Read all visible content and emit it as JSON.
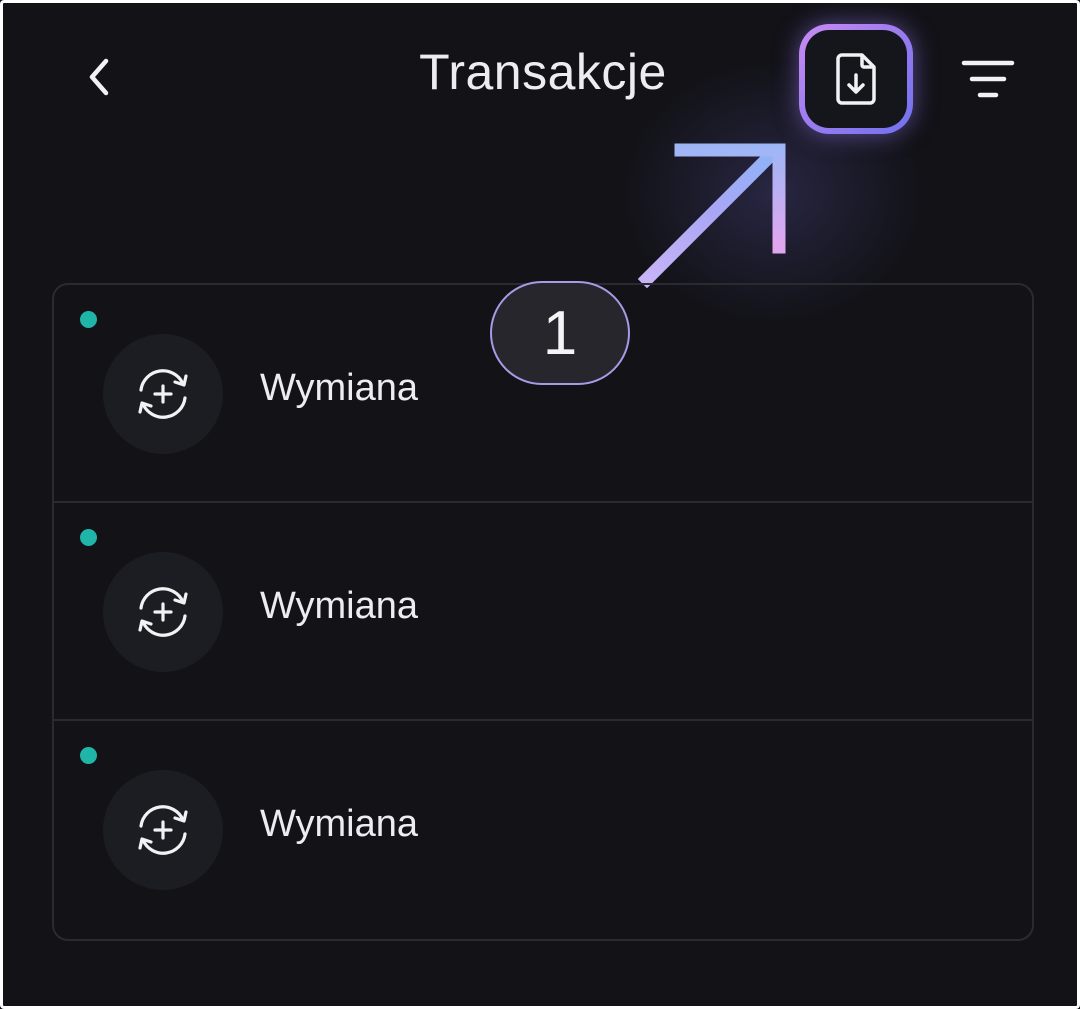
{
  "header": {
    "title": "Transakcje",
    "back_icon": "chevron-left-icon",
    "export_icon": "file-download-icon",
    "filter_icon": "filter-lines-icon"
  },
  "annotation": {
    "step_number": "1"
  },
  "colors": {
    "background": "#121217",
    "status_dot": "#1fb5a8",
    "highlight_border_start": "#c98bf2",
    "highlight_border_end": "#6f72ef"
  },
  "transactions": [
    {
      "label": "Wymiana",
      "icon": "exchange-add-icon"
    },
    {
      "label": "Wymiana",
      "icon": "exchange-add-icon"
    },
    {
      "label": "Wymiana",
      "icon": "exchange-add-icon"
    }
  ]
}
